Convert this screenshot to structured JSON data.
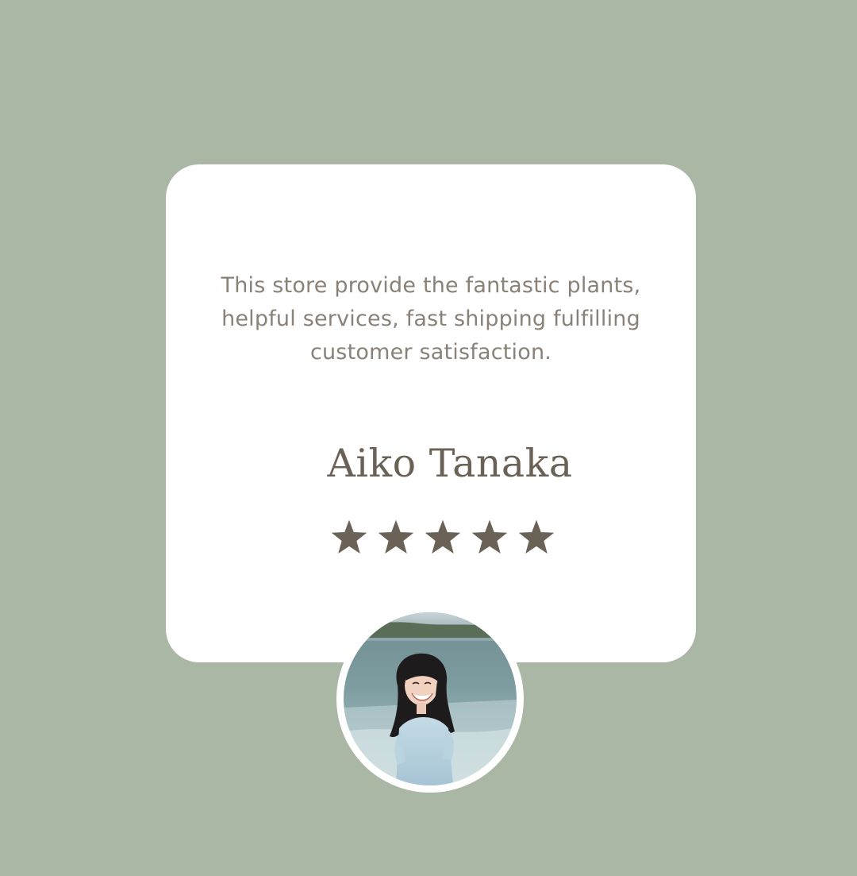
{
  "testimonial": {
    "quote_lines": [
      "This store provide the fantastic plants,",
      "helpful services, fast shipping fulfilling",
      "customer satisfaction."
    ],
    "reviewer_name": "Aiko Tanaka",
    "rating": 5,
    "rating_max": 5
  },
  "colors": {
    "background": "#aab7a4",
    "card": "#ffffff",
    "quote_text": "#8a8178",
    "name_text": "#6b6257",
    "star": "#6b6257"
  },
  "icons": {
    "star": "star-icon",
    "avatar": "reviewer-photo"
  }
}
